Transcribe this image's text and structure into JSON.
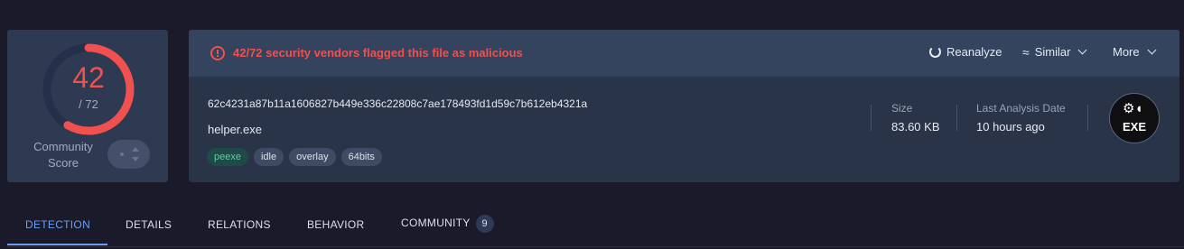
{
  "score": {
    "detections": "42",
    "total": "/ 72",
    "community_label": "Community\nScore"
  },
  "alert": {
    "text": "42/72 security vendors flagged this file as malicious"
  },
  "actions": {
    "reanalyze": "Reanalyze",
    "similar": "Similar",
    "more": "More"
  },
  "file": {
    "hash": "62c4231a87b11a1606827b449e336c22808c7ae178493fd1d59c7b612eb4321a",
    "name": "helper.exe",
    "tags": [
      "peexe",
      "idle",
      "overlay",
      "64bits"
    ],
    "size_label": "Size",
    "size_value": "83.60 KB",
    "date_label": "Last Analysis Date",
    "date_value": "10 hours ago",
    "type_label": "EXE"
  },
  "tabs": {
    "detection": "DETECTION",
    "details": "DETAILS",
    "relations": "RELATIONS",
    "behavior": "BEHAVIOR",
    "community": "COMMUNITY",
    "community_count": "9"
  },
  "colors": {
    "malicious": "#f0504e",
    "accent": "#6a9ef2",
    "tag_green": "#5ccfa1"
  },
  "gauge": {
    "fraction": 0.583
  }
}
